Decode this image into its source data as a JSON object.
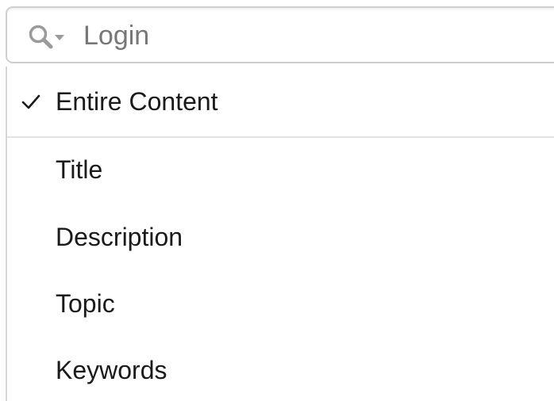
{
  "search": {
    "placeholder": "Login",
    "value": "",
    "icon": "search-with-dropdown-icon"
  },
  "menu": {
    "checked_icon": "checkmark-icon",
    "items": [
      {
        "label": "Entire Content",
        "checked": true
      },
      {
        "label": "Title",
        "checked": false
      },
      {
        "label": "Description",
        "checked": false
      },
      {
        "label": "Topic",
        "checked": false
      },
      {
        "label": "Keywords",
        "checked": false
      }
    ]
  },
  "colors": {
    "field_border": "#cfcfcf",
    "divider": "#e2e2e2",
    "icon": "#9a9a9a",
    "text": "#1a1a1a",
    "placeholder": "#777777"
  }
}
